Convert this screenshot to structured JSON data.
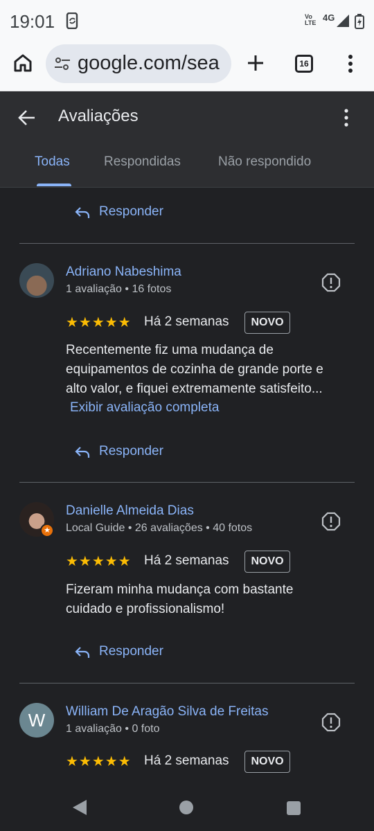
{
  "status_bar": {
    "time": "19:01",
    "network_label": "4G",
    "volte_label": "Vo LTE",
    "icons": [
      "sync-phone-icon",
      "signal-icon",
      "battery-icon"
    ]
  },
  "browser": {
    "url": "google.com/sea",
    "tab_count": "16",
    "icons": [
      "home-icon",
      "tune-icon",
      "new-tab-icon",
      "overflow-menu-icon"
    ]
  },
  "header": {
    "title": "Avaliações",
    "tabs": [
      {
        "label": "Todas",
        "active": true
      },
      {
        "label": "Respondidas",
        "active": false
      },
      {
        "label": "Não respondido",
        "active": false
      }
    ]
  },
  "reply_label": "Responder",
  "reviews": [
    {
      "name": "Adriano Nabeshima",
      "meta": "1 avaliação • 16 fotos",
      "rating": 5,
      "stars": "★★★★★",
      "when": "Há 2 semanas",
      "badge": "NOVO",
      "text": "Recentemente fiz uma mudança de equipamentos de cozinha de grande porte e alto valor, e fiquei extremamente satisfeito...",
      "more_link": "Exibir avaliação completa"
    },
    {
      "name": "Danielle Almeida Dias",
      "meta": "Local Guide • 26 avaliações • 40 fotos",
      "guide_badge": "★",
      "rating": 5,
      "stars": "★★★★★",
      "when": "Há 2 semanas",
      "badge": "NOVO",
      "text": "Fizeram minha mudança com bastante cuidado e profissionalismo!"
    },
    {
      "name": "William De Aragão Silva de Freitas",
      "avatar_letter": "W",
      "meta": "1 avaliação • 0 foto",
      "rating": 5,
      "stars": "★★★★★",
      "when": "Há 2 semanas",
      "badge": "NOVO"
    }
  ],
  "colors": {
    "accent": "#8ab4f8",
    "star": "#fbbc04",
    "background": "#202124"
  }
}
